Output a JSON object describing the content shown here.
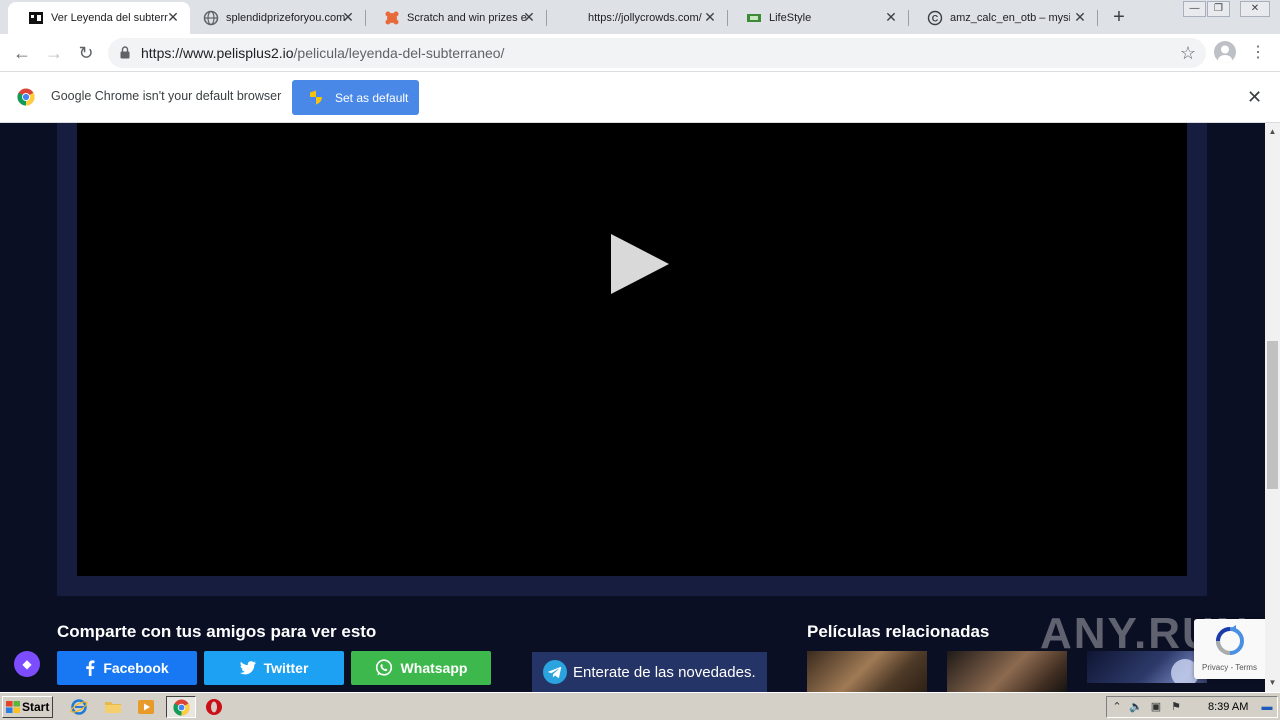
{
  "browser": {
    "tabs": [
      {
        "title": "Ver Leyenda del subterr",
        "icon": "film-icon",
        "active": true
      },
      {
        "title": "splendidprizeforyou.com",
        "icon": "globe-icon",
        "active": false
      },
      {
        "title": "Scratch and win prizes e",
        "icon": "scratch-icon",
        "active": false
      },
      {
        "title": "https://jollycrowds.com/",
        "icon": "none",
        "active": false
      },
      {
        "title": "LifeStyle",
        "icon": "lifestyle-icon",
        "active": false
      },
      {
        "title": "amz_calc_en_otb – mysi",
        "icon": "c-icon",
        "active": false
      }
    ],
    "address": {
      "host": "https://www.pelisplus2.io",
      "path": "/pelicula/leyenda-del-subterraneo/"
    },
    "infobar": {
      "message": "Google Chrome isn't your default browser",
      "button_label": "Set as default"
    }
  },
  "page": {
    "share_heading": "Comparte con tus amigos para ver esto",
    "share_buttons": {
      "facebook": "Facebook",
      "twitter": "Twitter",
      "whatsapp": "Whatsapp"
    },
    "telegram_label": "Enterate de las novedades.",
    "related_heading": "Películas relacionadas",
    "watermark": "ANY.RUN",
    "recaptcha_terms": "Privacy - Terms",
    "colors": {
      "background": "#0b0f24",
      "facebook": "#1877f2",
      "twitter": "#1da1f2",
      "whatsapp": "#3db84c",
      "telegram": "#253466"
    }
  },
  "taskbar": {
    "start_label": "Start",
    "clock": "8:39 AM"
  }
}
